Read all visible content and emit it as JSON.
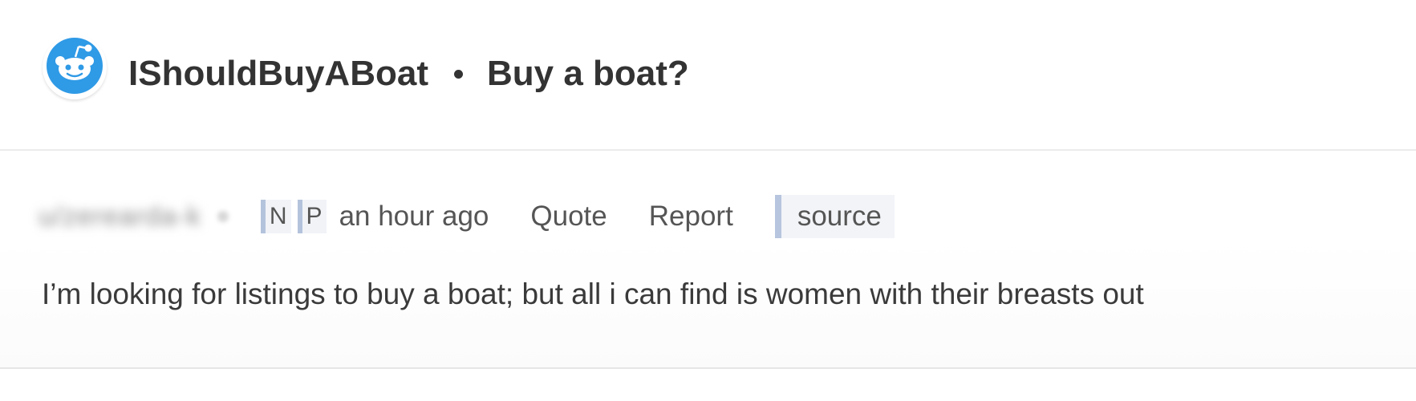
{
  "header": {
    "subreddit": "IShouldBuyABoat",
    "thread_title": "Buy a boat?",
    "icon": "reddit-snoo-icon",
    "icon_color": "#2f9ae6"
  },
  "comment": {
    "username": "u/zerearda-k",
    "tags": [
      "N",
      "P"
    ],
    "timestamp": "an hour ago",
    "actions": {
      "quote": "Quote",
      "report": "Report",
      "source": "source"
    },
    "body": "I’m looking for listings to buy a boat; but all i can find is women with their breasts out"
  },
  "colors": {
    "tag_border": "#b4c3dc",
    "tag_background": "#f1f3f7",
    "divider": "#ececec"
  }
}
